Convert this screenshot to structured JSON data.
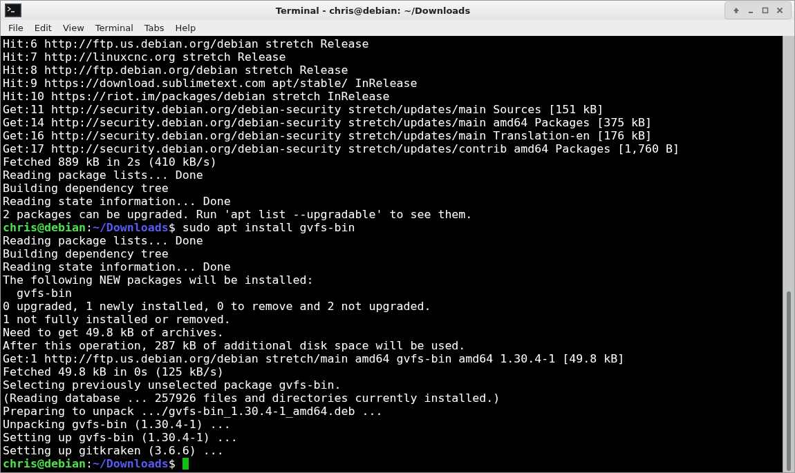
{
  "window": {
    "title": "Terminal - chris@debian: ~/Downloads"
  },
  "menu": [
    "File",
    "Edit",
    "View",
    "Terminal",
    "Tabs",
    "Help"
  ],
  "terminal": {
    "lines": [
      {
        "kind": "output",
        "text": "Hit:6 http://ftp.us.debian.org/debian stretch Release"
      },
      {
        "kind": "output",
        "text": "Hit:7 http://linuxcnc.org stretch Release"
      },
      {
        "kind": "output",
        "text": "Hit:8 http://ftp.debian.org/debian stretch Release"
      },
      {
        "kind": "output",
        "text": "Hit:9 https://download.sublimetext.com apt/stable/ InRelease"
      },
      {
        "kind": "output",
        "text": "Hit:10 https://riot.im/packages/debian stretch InRelease"
      },
      {
        "kind": "output",
        "text": "Get:11 http://security.debian.org/debian-security stretch/updates/main Sources [151 kB]"
      },
      {
        "kind": "output",
        "text": "Get:14 http://security.debian.org/debian-security stretch/updates/main amd64 Packages [375 kB]"
      },
      {
        "kind": "output",
        "text": "Get:16 http://security.debian.org/debian-security stretch/updates/main Translation-en [176 kB]"
      },
      {
        "kind": "output",
        "text": "Get:17 http://security.debian.org/debian-security stretch/updates/contrib amd64 Packages [1,760 B]"
      },
      {
        "kind": "output",
        "text": "Fetched 889 kB in 2s (410 kB/s)"
      },
      {
        "kind": "output",
        "text": "Reading package lists... Done"
      },
      {
        "kind": "output",
        "text": "Building dependency tree"
      },
      {
        "kind": "output",
        "text": "Reading state information... Done"
      },
      {
        "kind": "output",
        "text": "2 packages can be upgraded. Run 'apt list --upgradable' to see them."
      },
      {
        "kind": "prompt",
        "user": "chris@debian",
        "sep": ":",
        "path": "~/Downloads",
        "sigil": "$",
        "command": "sudo apt install gvfs-bin"
      },
      {
        "kind": "output",
        "text": "Reading package lists... Done"
      },
      {
        "kind": "output",
        "text": "Building dependency tree"
      },
      {
        "kind": "output",
        "text": "Reading state information... Done"
      },
      {
        "kind": "output",
        "text": "The following NEW packages will be installed:"
      },
      {
        "kind": "output",
        "text": "  gvfs-bin"
      },
      {
        "kind": "output",
        "text": "0 upgraded, 1 newly installed, 0 to remove and 2 not upgraded."
      },
      {
        "kind": "output",
        "text": "1 not fully installed or removed."
      },
      {
        "kind": "output",
        "text": "Need to get 49.8 kB of archives."
      },
      {
        "kind": "output",
        "text": "After this operation, 287 kB of additional disk space will be used."
      },
      {
        "kind": "output",
        "text": "Get:1 http://ftp.us.debian.org/debian stretch/main amd64 gvfs-bin amd64 1.30.4-1 [49.8 kB]"
      },
      {
        "kind": "output",
        "text": "Fetched 49.8 kB in 0s (125 kB/s)"
      },
      {
        "kind": "output",
        "text": "Selecting previously unselected package gvfs-bin."
      },
      {
        "kind": "output",
        "text": "(Reading database ... 257926 files and directories currently installed.)"
      },
      {
        "kind": "output",
        "text": "Preparing to unpack .../gvfs-bin_1.30.4-1_amd64.deb ..."
      },
      {
        "kind": "output",
        "text": "Unpacking gvfs-bin (1.30.4-1) ..."
      },
      {
        "kind": "output",
        "text": "Setting up gvfs-bin (1.30.4-1) ..."
      },
      {
        "kind": "output",
        "text": "Setting up gitkraken (3.6.6) ..."
      },
      {
        "kind": "prompt",
        "user": "chris@debian",
        "sep": ":",
        "path": "~/Downloads",
        "sigil": "$",
        "cursor": true
      }
    ]
  }
}
